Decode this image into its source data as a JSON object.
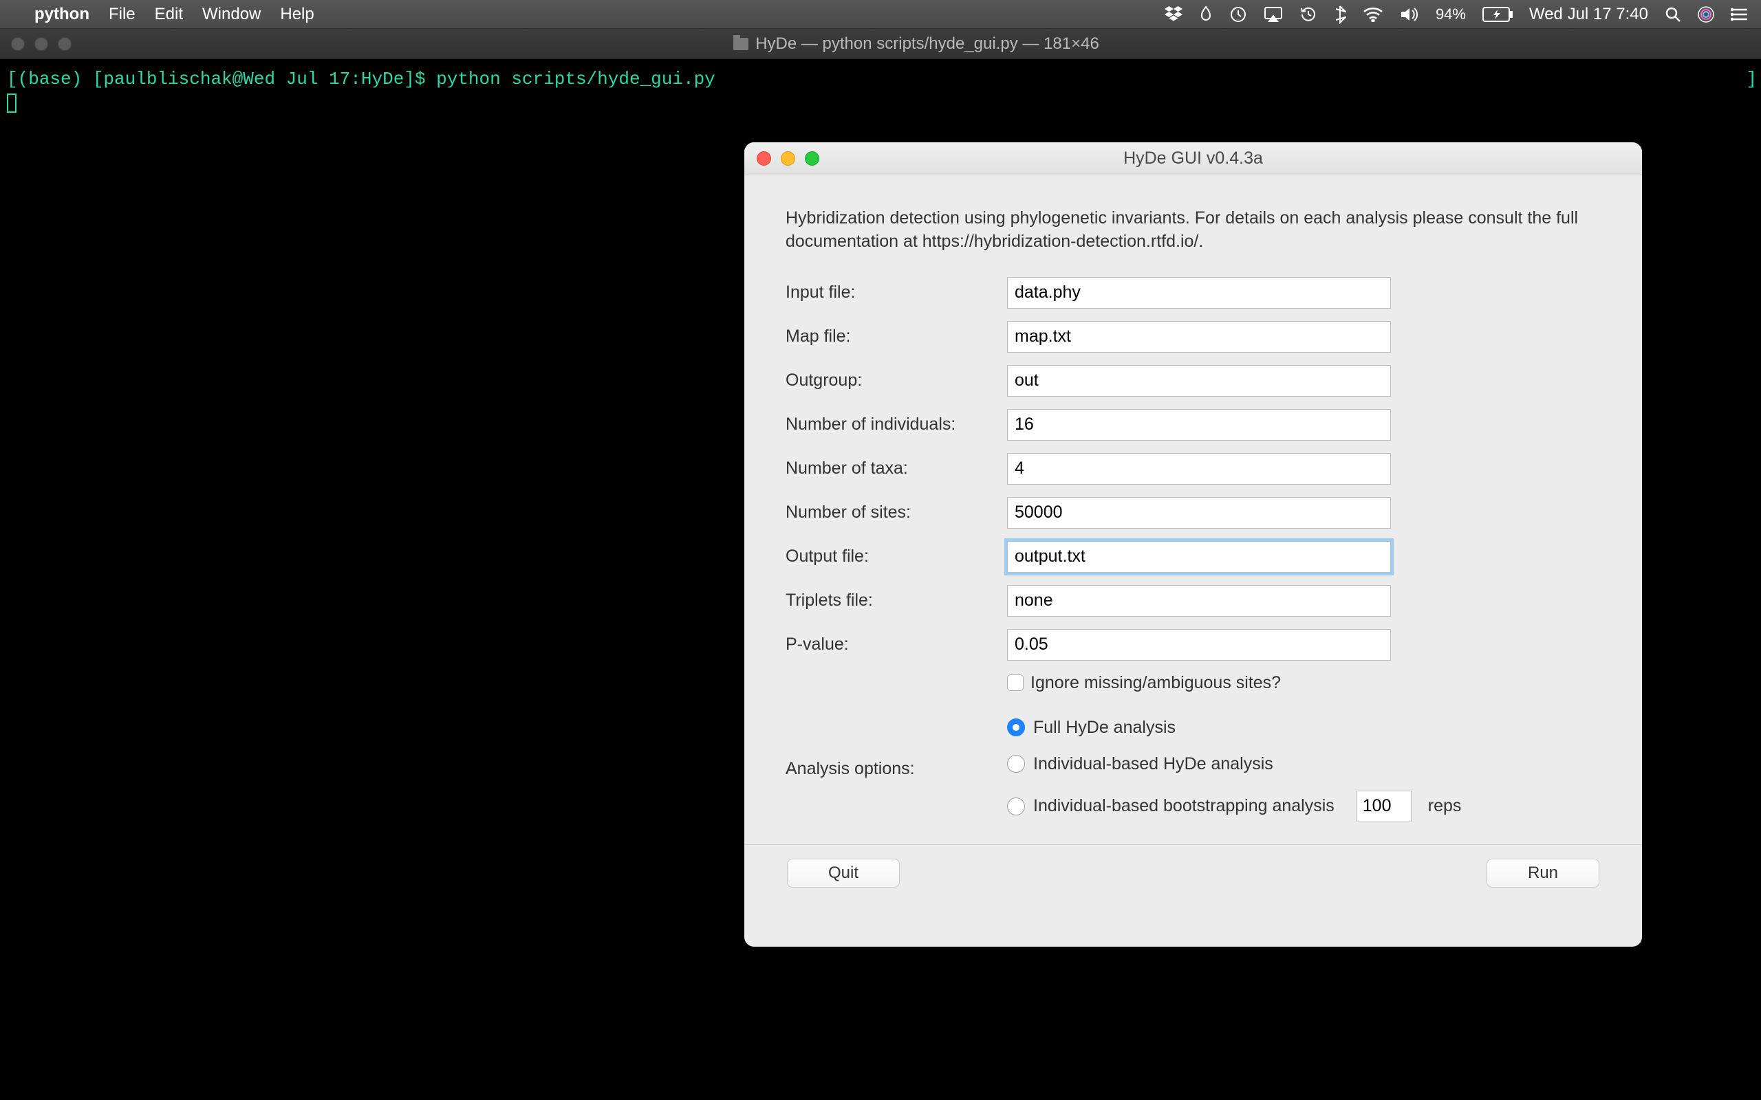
{
  "menubar": {
    "app": "python",
    "items": [
      "File",
      "Edit",
      "Window",
      "Help"
    ],
    "battery": "94%",
    "clock": "Wed Jul 17  7:40"
  },
  "terminal": {
    "window_title": "HyDe — python scripts/hyde_gui.py — 181×46",
    "prompt_prefix": "(base) [paulblischak@Wed Jul 17:HyDe]$ ",
    "command": "python scripts/hyde_gui.py"
  },
  "gui": {
    "title": "HyDe GUI v0.4.3a",
    "intro": "Hybridization detection using phylogenetic invariants. For details on each analysis please consult the full documentation at https://hybridization-detection.rtfd.io/.",
    "fields": {
      "input_file": {
        "label": "Input file:",
        "value": "data.phy"
      },
      "map_file": {
        "label": "Map file:",
        "value": "map.txt"
      },
      "outgroup": {
        "label": "Outgroup:",
        "value": "out"
      },
      "num_ind": {
        "label": "Number of individuals:",
        "value": "16"
      },
      "num_taxa": {
        "label": "Number of taxa:",
        "value": "4"
      },
      "num_sites": {
        "label": "Number of sites:",
        "value": "50000"
      },
      "output_file": {
        "label": "Output file:",
        "value": "output.txt"
      },
      "triplets": {
        "label": "Triplets file:",
        "value": "none"
      },
      "pvalue": {
        "label": "P-value:",
        "value": "0.05"
      }
    },
    "ignore_checkbox": {
      "label": "Ignore missing/ambiguous sites?",
      "checked": false
    },
    "analysis_label": "Analysis options:",
    "radios": {
      "full": {
        "label": "Full HyDe analysis",
        "selected": true
      },
      "indiv": {
        "label": "Individual-based HyDe analysis",
        "selected": false
      },
      "boot": {
        "label": "Individual-based bootstrapping analysis",
        "selected": false,
        "reps": "100",
        "reps_suffix": "reps"
      }
    },
    "buttons": {
      "quit": "Quit",
      "run": "Run"
    }
  }
}
